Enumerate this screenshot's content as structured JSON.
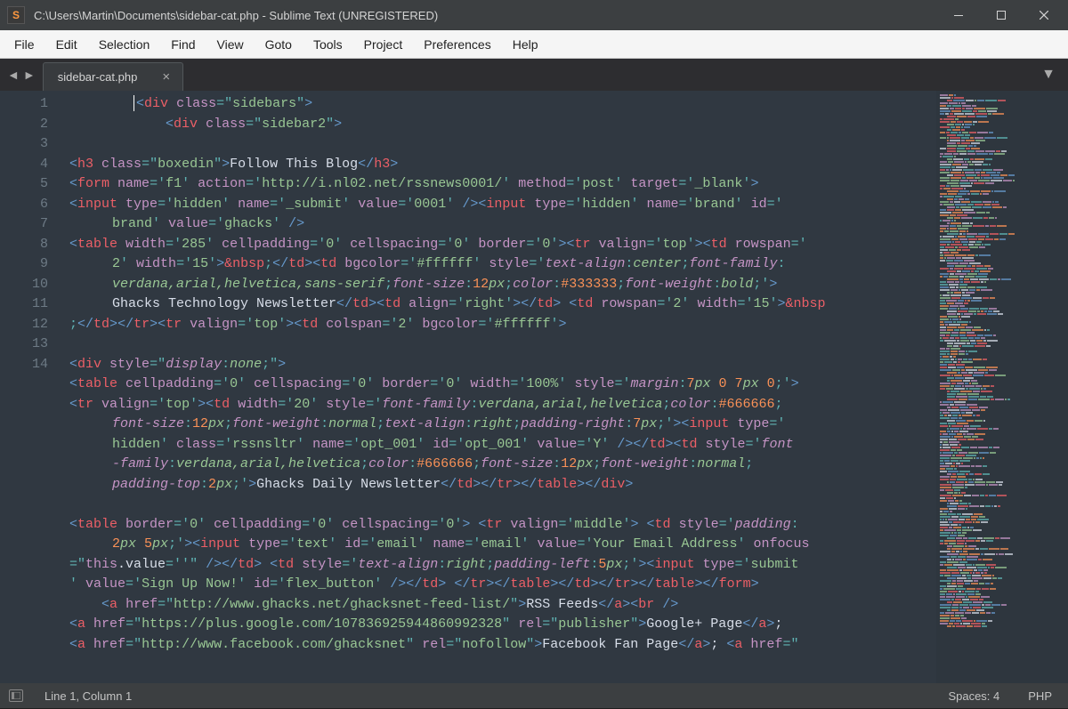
{
  "window": {
    "title": "C:\\Users\\Martin\\Documents\\sidebar-cat.php - Sublime Text (UNREGISTERED)",
    "icon_letter": "S"
  },
  "menubar": [
    "File",
    "Edit",
    "Selection",
    "Find",
    "View",
    "Goto",
    "Tools",
    "Project",
    "Preferences",
    "Help"
  ],
  "tabs": {
    "active": "sidebar-cat.php"
  },
  "gutter_lines": [
    "1",
    "2",
    "3",
    "4",
    "5",
    "6",
    "",
    "7",
    "",
    "",
    "",
    "8",
    "9",
    "10",
    "",
    "",
    "",
    "",
    "",
    "11",
    "12",
    "",
    "",
    "",
    "13",
    "14",
    "",
    ""
  ],
  "statusbar": {
    "position": "Line 1, Column 1",
    "spaces": "Spaces: 4",
    "syntax": "PHP"
  },
  "code": {
    "l1": {
      "indent": "        ",
      "tag": "div",
      "attr": "class",
      "val": "sidebars"
    },
    "l2": {
      "indent": "            ",
      "tag": "div",
      "attr": "class",
      "val": "sidebar2"
    },
    "l4a": {
      "tag": "h3",
      "attr": "class",
      "val": "boxedin",
      "text": "Follow This Blog"
    },
    "l5": {
      "tag": "form",
      "pairs": [
        [
          "name",
          "f1"
        ],
        [
          "action",
          "http://i.nl02.net/rssnews0001/"
        ],
        [
          "method",
          "post"
        ],
        [
          "target",
          "_blank"
        ]
      ]
    },
    "l6a": {
      "tag": "input",
      "pairs": [
        [
          "type",
          "hidden"
        ],
        [
          "name",
          "_submit"
        ],
        [
          "value",
          "0001"
        ]
      ]
    },
    "l6b": {
      "tag": "input",
      "pairs": [
        [
          "type",
          "hidden"
        ],
        [
          "name",
          "brand"
        ]
      ],
      "tail": [
        [
          "id",
          "brand"
        ],
        [
          "value",
          "ghacks"
        ]
      ]
    },
    "l7_table": {
      "pairs": [
        [
          "width",
          "285"
        ],
        [
          "cellpadding",
          "0"
        ],
        [
          "cellspacing",
          "0"
        ],
        [
          "border",
          "0"
        ]
      ]
    },
    "l7_tr": {
      "key": "valign",
      "val": "top"
    },
    "l7_td1": {
      "pairs": [
        [
          "rowspan",
          "2"
        ],
        [
          "width",
          "15"
        ]
      ]
    },
    "l7_td2_bg": "#ffffff",
    "l7_td2_style": {
      "props": [
        [
          "text-align",
          "center"
        ],
        [
          "font-family",
          ""
        ]
      ]
    },
    "l7_fonts": "verdana,arial,helvetica,sans-serif",
    "l7_style2": [
      [
        "font-size",
        "12"
      ],
      [
        "color",
        "#333333"
      ],
      [
        "font-weight",
        "bold"
      ]
    ],
    "l7_text": "Ghacks Technology Newsletter",
    "l7_td3": {
      "key": "align",
      "val": "right"
    },
    "l7_td4": {
      "pairs": [
        [
          "rowspan",
          "2"
        ],
        [
          "width",
          "15"
        ]
      ]
    },
    "l7_tr2": {
      "key": "valign",
      "val": "top"
    },
    "l7_td5": {
      "pairs": [
        [
          "colspan",
          "2"
        ],
        [
          "bgcolor",
          "#ffffff"
        ]
      ]
    },
    "l9": {
      "prop": "display",
      "val": "none"
    },
    "l10_table": {
      "pairs": [
        [
          "cellpadding",
          "0"
        ],
        [
          "cellspacing",
          "0"
        ],
        [
          "border",
          "0"
        ],
        [
          "width",
          "100%"
        ]
      ],
      "styleprop": "margin",
      "styleval": "7px 0 7px 0"
    },
    "l10_tr": {
      "key": "valign",
      "val": "top"
    },
    "l10_td": {
      "key": "width",
      "val": "20"
    },
    "l10_tdstyle": [
      [
        "font-family",
        "verdana,arial,helvetica"
      ],
      [
        "color",
        "#666666"
      ]
    ],
    "l10_tdstyle2": [
      [
        "font-size",
        "12"
      ],
      [
        "font-weight",
        "normal"
      ],
      [
        "text-align",
        "right"
      ],
      [
        "padding-right",
        "7"
      ]
    ],
    "l10_input": {
      "pairs": [
        [
          "type",
          "hidden"
        ],
        [
          "class",
          "rssnsltr"
        ],
        [
          "name",
          "opt_001"
        ],
        [
          "id",
          "opt_001"
        ],
        [
          "value",
          "Y"
        ]
      ]
    },
    "l10_td2style": [
      [
        "font-family",
        "verdana,arial,helvetica"
      ],
      [
        "color",
        "#666666"
      ],
      [
        "font-size",
        "12"
      ],
      [
        "font-weight",
        "normal"
      ]
    ],
    "l10_td2style2": [
      [
        "padding-top",
        "2"
      ]
    ],
    "l10_text": "Ghacks Daily Newsletter",
    "l12_table": {
      "pairs": [
        [
          "border",
          "0"
        ],
        [
          "cellpadding",
          "0"
        ],
        [
          "cellspacing",
          "0"
        ]
      ]
    },
    "l12_tr": {
      "key": "valign",
      "val": "middle"
    },
    "l12_tdstyle": [
      [
        "padding",
        "2px 5px"
      ]
    ],
    "l12_input": {
      "pairs": [
        [
          "type",
          "text"
        ],
        [
          "id",
          "email"
        ],
        [
          "name",
          "email"
        ],
        [
          "value",
          "Your Email Address"
        ]
      ],
      "onfocus": "this.value=''"
    },
    "l12_td2style": [
      [
        "text-align",
        "right"
      ],
      [
        "padding-left",
        "5"
      ]
    ],
    "l12_input2": {
      "pairs": [
        [
          "type",
          "submit"
        ],
        [
          "value",
          "Sign Up Now!"
        ],
        [
          "id",
          "flex_button"
        ]
      ]
    },
    "l13": {
      "href": "http://www.ghacks.net/ghacksnet-feed-list/",
      "text": "RSS Feeds"
    },
    "l14a": {
      "href": "https://plus.google.com/107836925944860992328",
      "rel": "publisher",
      "text": "Google+ Page"
    },
    "l14b": {
      "href": "http://www.facebook.com/ghacksnet",
      "rel": "nofollow",
      "text": "Facebook Fan Page"
    }
  }
}
